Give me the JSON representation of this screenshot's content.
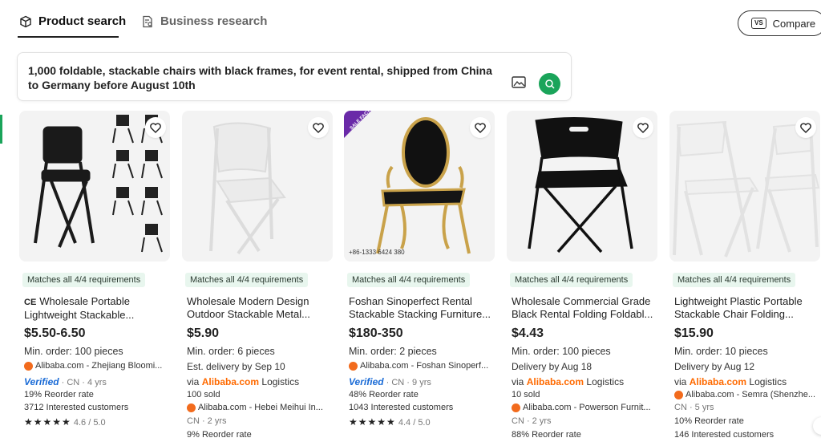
{
  "tabs": {
    "product_search": "Product search",
    "business_research": "Business research"
  },
  "compare": {
    "label": "Compare",
    "icon_text": "VS"
  },
  "query": {
    "line1": "1,000 foldable, stackable chairs with black frames, for event rental, shipped from China",
    "line2": "to Germany before August 10th"
  },
  "products": [
    {
      "badge": "Matches all 4/4 requirements",
      "title_prefix": "CE",
      "title_line1": "Wholesale Portable",
      "title_line2": "Lightweight Stackable...",
      "price": "$5.50-6.50",
      "min_order": "Min. order: 100 pieces",
      "supplier": "Alibaba.com - Zhejiang Bloomi...",
      "verified": "Verified",
      "country": "· CN · 4 yrs",
      "reorder": "19% Reorder rate",
      "interested": "3712 Interested customers",
      "stars": "★★★★★",
      "rating": "4.6 / 5.0"
    },
    {
      "badge": "Matches all 4/4 requirements",
      "title_line1": "Wholesale Modern Design",
      "title_line2": "Outdoor Stackable Metal...",
      "price": "$5.90",
      "min_order": "Min. order: 6 pieces",
      "delivery": "Est. delivery by Sep 10",
      "via": "via",
      "logistics_brand": "Alibaba.com",
      "logistics": "Logistics",
      "sold": "100 sold",
      "supplier": "Alibaba.com - Hebei Meihui In...",
      "country": "CN · 2 yrs",
      "reorder": "9% Reorder rate"
    },
    {
      "badge": "Matches all 4/4 requirements",
      "title_line1": "Foshan Sinoperfect Rental",
      "title_line2": "Stackable Stacking Furniture...",
      "price": "$180-350",
      "min_order": "Min. order: 2 pieces",
      "supplier": "Alibaba.com - Foshan Sinoperf...",
      "verified": "Verified",
      "country": "· CN · 9 yrs",
      "reorder": "48% Reorder rate",
      "interested": "1043 Interested customers",
      "stars": "★★★★★",
      "rating": "4.4 / 5.0",
      "sale_tag": "SALE FACTORY",
      "phone": "+86-1333 6424 380"
    },
    {
      "badge": "Matches all 4/4 requirements",
      "title_line1": "Wholesale Commercial Grade",
      "title_line2": "Black Rental Folding Foldabl...",
      "price": "$4.43",
      "min_order": "Min. order: 100 pieces",
      "delivery": "Delivery by Aug 18",
      "via": "via",
      "logistics_brand": "Alibaba.com",
      "logistics": "Logistics",
      "sold": "10 sold",
      "supplier": "Alibaba.com - Powerson Furnit...",
      "country": "CN · 2 yrs",
      "reorder": "88% Reorder rate"
    },
    {
      "badge": "Matches all 4/4 requirements",
      "title_line1": "Lightweight Plastic Portable",
      "title_line2": "Stackable Chair Folding...",
      "price": "$15.90",
      "min_order": "Min. order: 10 pieces",
      "delivery": "Delivery by Aug 12",
      "via": "via",
      "logistics_brand": "Alibaba.com",
      "logistics": "Logistics",
      "supplier": "Alibaba.com - Semra (Shenzhe...",
      "country": "CN · 5 yrs",
      "reorder": "10% Reorder rate",
      "interested": "146 Interested customers"
    }
  ],
  "colors": {
    "accent": "#1aa45a",
    "alibaba": "#ff6a00",
    "verified": "#1a6bd6",
    "badge_bg": "#e8f6ee"
  }
}
